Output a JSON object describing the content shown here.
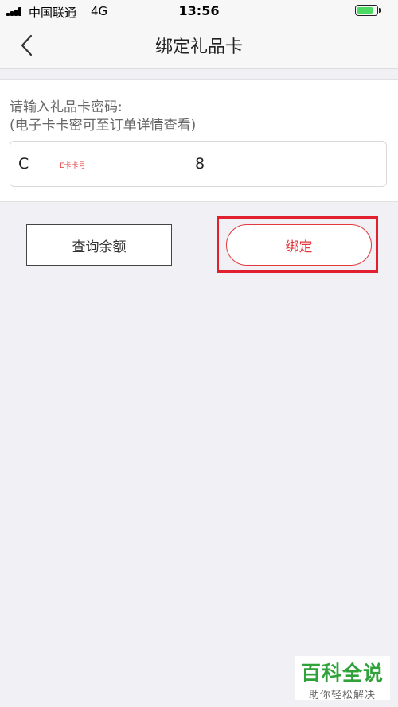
{
  "status_bar": {
    "carrier": "中国联通",
    "network": "4G",
    "time": "13:56",
    "battery_level": 0.85
  },
  "nav": {
    "title": "绑定礼品卡"
  },
  "form": {
    "prompt_line1": "请输入礼品卡密码:",
    "prompt_line2": "(电子卡卡密可至订单详情查看)",
    "input_start": "C",
    "input_hint": "E卡卡号",
    "input_end": "8"
  },
  "buttons": {
    "balance_label": "查询余额",
    "bind_label": "绑定"
  },
  "watermark": {
    "title": "百科全说",
    "subtitle": "助你轻松解决"
  },
  "colors": {
    "accent": "#e3393c",
    "highlight": "#e0202e",
    "background": "#f0f0f5",
    "battery": "#4cd964",
    "watermark_green": "#2fa33a"
  }
}
